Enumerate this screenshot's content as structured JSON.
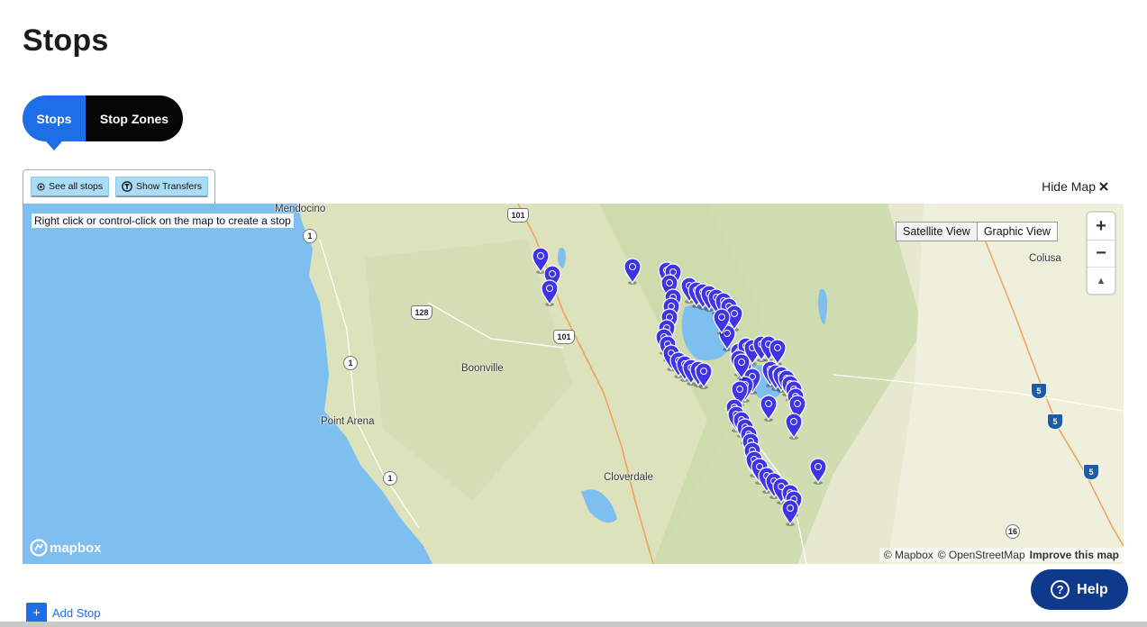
{
  "page": {
    "title": "Stops"
  },
  "tabs": [
    {
      "label": "Stops",
      "active": true
    },
    {
      "label": "Stop Zones",
      "active": false
    }
  ],
  "toolbar": {
    "see_all_label": "See all stops",
    "see_all_icon": "target-icon",
    "show_transfers_label": "Show Transfers",
    "show_transfers_icon": "transfer-t-icon"
  },
  "hide_map": {
    "label": "Hide Map",
    "icon": "close-icon"
  },
  "map": {
    "hint": "Right click or control-click on the map to create a stop",
    "views": [
      "Satellite View",
      "Graphic View"
    ],
    "zoom_in": "+",
    "zoom_out": "−",
    "compass": "▲",
    "logo": "mapbox",
    "attribution": [
      "© Mapbox",
      "© OpenStreetMap"
    ],
    "improve": "Improve this map",
    "places": [
      {
        "name": "Mendocino"
      },
      {
        "name": "Boonville"
      },
      {
        "name": "Point Arena"
      },
      {
        "name": "Cloverdale"
      },
      {
        "name": "Colusa"
      }
    ],
    "routes": [
      "101",
      "1",
      "128",
      "101",
      "1",
      "1",
      "5",
      "5",
      "5",
      "16"
    ],
    "colors": {
      "water": "#7fbff0",
      "land": "#e5e8cf",
      "marker": "#3f33e6"
    }
  },
  "actions": {
    "add_stop": "Add Stop",
    "help": "Help"
  }
}
